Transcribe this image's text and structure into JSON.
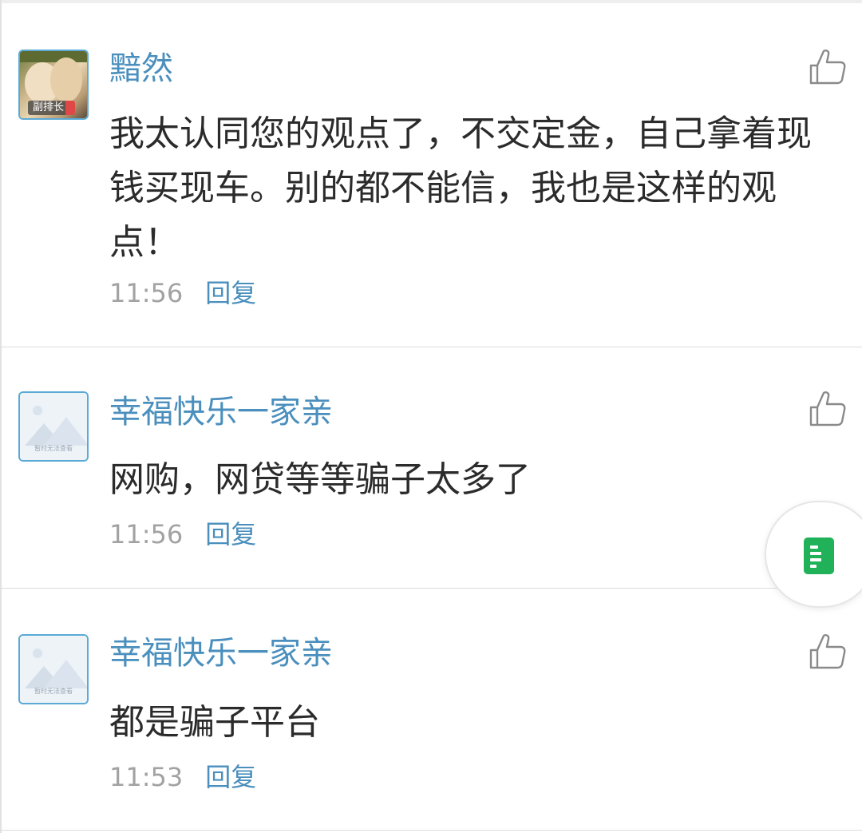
{
  "comments": [
    {
      "username": "黯然",
      "avatar_badge": "副排长",
      "content": "我太认同您的观点了，不交定金，自己拿着现钱买现车。别的都不能信，我也是这样的观点！",
      "time": "11:56",
      "reply_label": "回复"
    },
    {
      "username": "幸福快乐一家亲",
      "avatar_caption": "暂时无法查看",
      "content": "网购，网贷等等骗子太多了",
      "time": "11:56",
      "reply_label": "回复"
    },
    {
      "username": "幸福快乐一家亲",
      "avatar_caption": "暂时无法查看",
      "content": "都是骗子平台",
      "time": "11:53",
      "reply_label": "回复"
    }
  ],
  "icons": {
    "like": "thumbs-up-icon",
    "floating": "document-icon"
  },
  "colors": {
    "username": "#4a8fbd",
    "reply": "#4a8fbd",
    "time": "#a2a2a2",
    "content": "#2b2b2b",
    "avatar_border": "#5aa9d6",
    "float_icon": "#21b259"
  }
}
